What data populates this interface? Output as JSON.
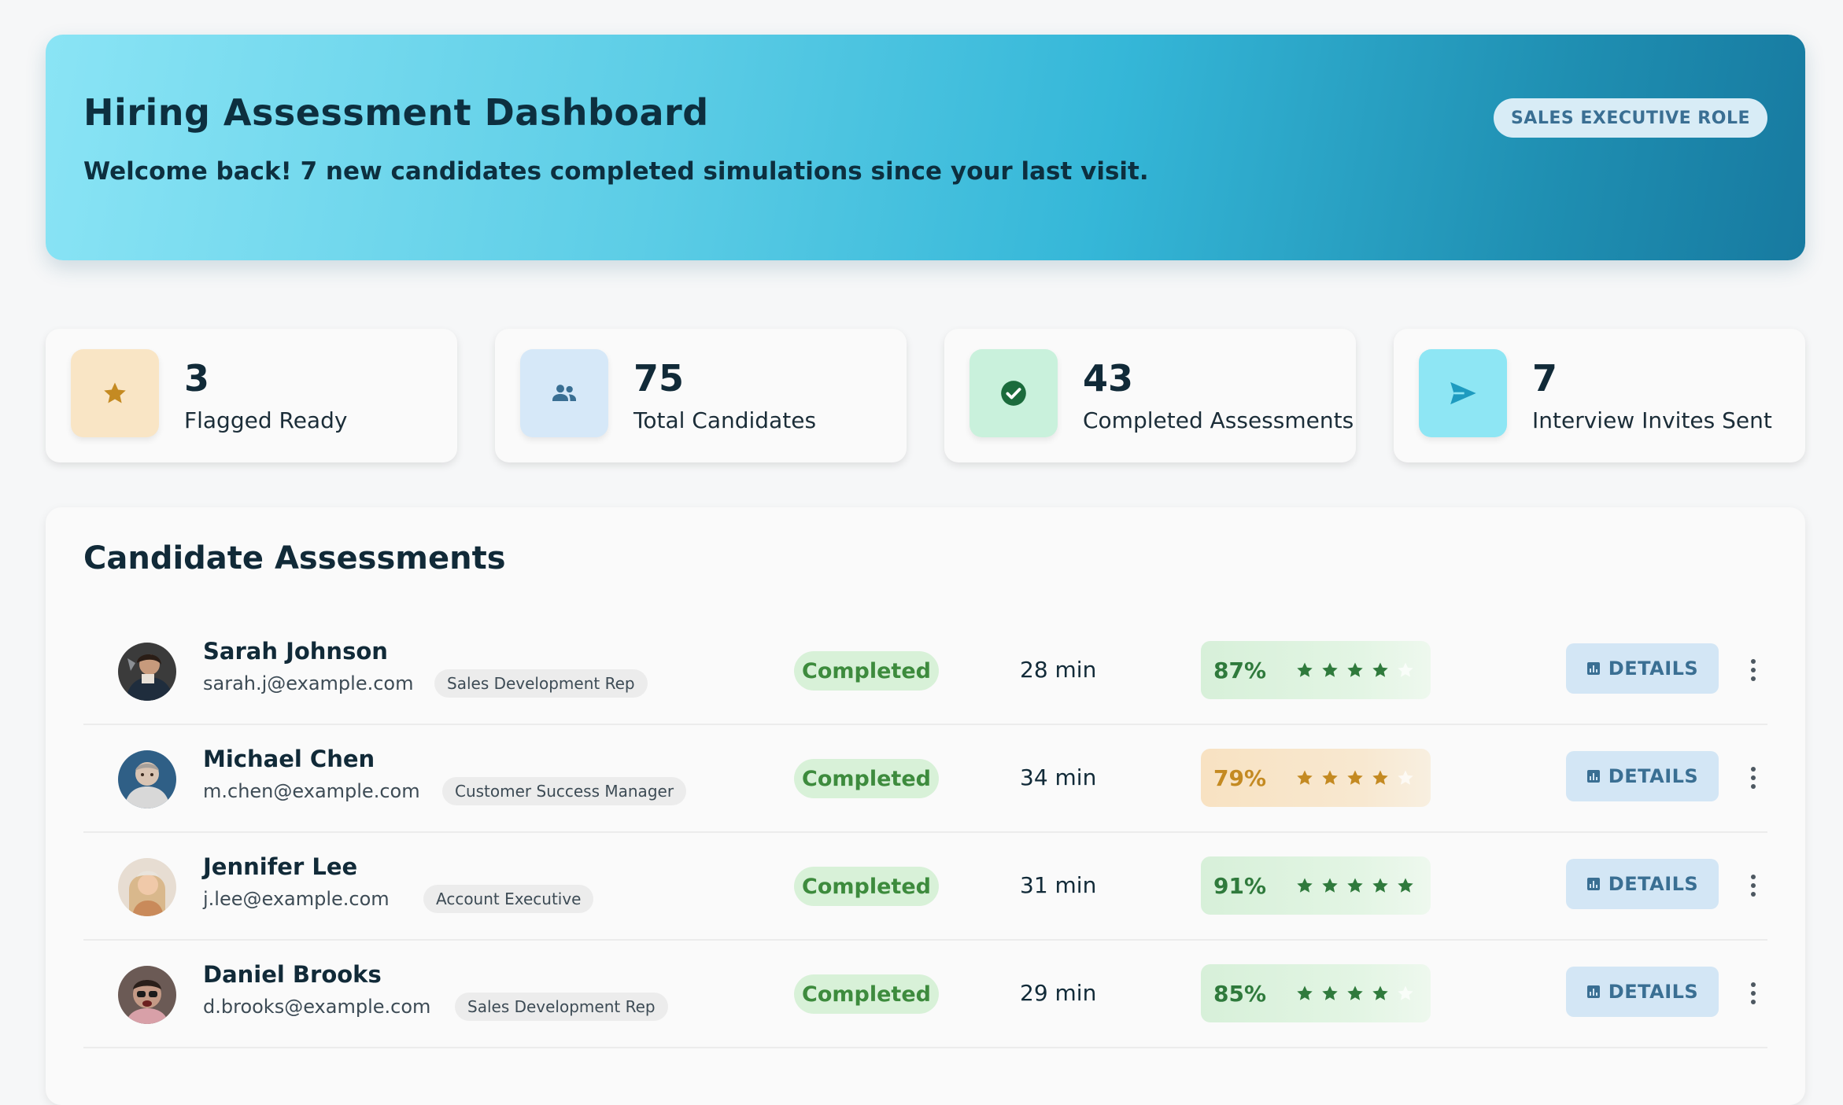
{
  "header": {
    "title": "Hiring Assessment Dashboard",
    "subtitle": "Welcome back! 7 new candidates completed simulations since your last visit.",
    "role_badge": "SALES EXECUTIVE ROLE"
  },
  "stats": [
    {
      "value": "3",
      "label": "Flagged Ready",
      "icon": "star-icon",
      "icon_bg": "#f9e5c5",
      "icon_color": "#c48a22"
    },
    {
      "value": "75",
      "label": "Total Candidates",
      "icon": "people-icon",
      "icon_bg": "#d6e8f8",
      "icon_color": "#3a6f93"
    },
    {
      "value": "43",
      "label": "Completed Assessments",
      "icon": "check-circle-icon",
      "icon_bg": "#c9f1dc",
      "icon_color": "#1b6b3c"
    },
    {
      "value": "7",
      "label": "Interview Invites Sent",
      "icon": "send-icon",
      "icon_bg": "#8ee6f4",
      "icon_color": "#1e9bc0"
    }
  ],
  "panel": {
    "title": "Candidate Assessments",
    "details_label": "DETAILS"
  },
  "candidates": [
    {
      "name": "Sarah Johnson",
      "email": "sarah.j@example.com",
      "role": "Sales Development Rep",
      "status": "Completed",
      "duration": "28 min",
      "score": "87%",
      "stars": 4,
      "tone": "green"
    },
    {
      "name": "Michael Chen",
      "email": "m.chen@example.com",
      "role": "Customer Success Manager",
      "status": "Completed",
      "duration": "34 min",
      "score": "79%",
      "stars": 4,
      "tone": "orange"
    },
    {
      "name": "Jennifer Lee",
      "email": "j.lee@example.com",
      "role": "Account Executive",
      "status": "Completed",
      "duration": "31 min",
      "score": "91%",
      "stars": 5,
      "tone": "green"
    },
    {
      "name": "Daniel Brooks",
      "email": "d.brooks@example.com",
      "role": "Sales Development Rep",
      "status": "Completed",
      "duration": "29 min",
      "score": "85%",
      "stars": 4,
      "tone": "green"
    }
  ],
  "colors": {
    "accent": "#35b7d8",
    "status_completed": "#3d8b3d",
    "star_green": "#2f7a3c",
    "star_orange": "#c48a22"
  }
}
